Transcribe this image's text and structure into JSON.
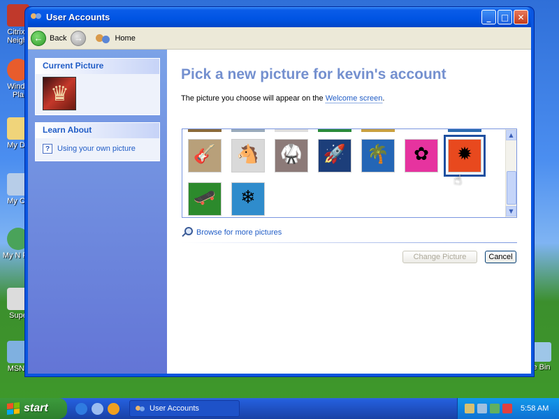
{
  "desktop": {
    "icons": [
      {
        "label": "Citrix I Neight",
        "icon": "citrix-icon"
      },
      {
        "label": "Windo Pla",
        "icon": "media-player-icon"
      },
      {
        "label": "My Do",
        "icon": "my-documents-icon"
      },
      {
        "label": "My Co",
        "icon": "my-computer-icon"
      },
      {
        "label": "My N Pla",
        "icon": "my-network-icon"
      },
      {
        "label": "Supe",
        "icon": "shortcut-icon"
      },
      {
        "label": "MSN I",
        "icon": "msn-icon"
      }
    ],
    "recycle_label": "e Bin"
  },
  "window": {
    "title": "User Accounts",
    "controls": {
      "minimize": "_",
      "maximize": "□",
      "close": "✕"
    }
  },
  "toolbar": {
    "back_label": "Back",
    "home_label": "Home"
  },
  "sidebar": {
    "current_picture_heading": "Current Picture",
    "learn_about_heading": "Learn About",
    "learn_items": [
      {
        "label": "Using your own picture"
      }
    ]
  },
  "main": {
    "title": "Pick a new picture for kevin's account",
    "subtitle_prefix": "The picture you choose will appear on the ",
    "subtitle_link": "Welcome screen",
    "subtitle_suffix": ".",
    "pictures": [
      {
        "name": "guitar",
        "glyph": "🎸",
        "bg": "#b8a07a"
      },
      {
        "name": "horses",
        "glyph": "🐴",
        "bg": "#d9d9d9"
      },
      {
        "name": "karate",
        "glyph": "🥋",
        "bg": "#8c7a78"
      },
      {
        "name": "space-shuttle",
        "glyph": "🚀",
        "bg": "#1c3e7a"
      },
      {
        "name": "palm-trees",
        "glyph": "🌴",
        "bg": "#2466b6"
      },
      {
        "name": "pink-flower",
        "glyph": "✿",
        "bg": "#e6339f"
      },
      {
        "name": "orange-flower",
        "glyph": "✹",
        "bg": "#e8491e",
        "selected": true
      },
      {
        "name": "skateboarder",
        "glyph": "🛹",
        "bg": "#2c8a2c"
      },
      {
        "name": "snowflake",
        "glyph": "❄",
        "bg": "#2f8ccc"
      }
    ],
    "browse_label": "Browse for more pictures",
    "change_button": "Change Picture",
    "cancel_button": "Cancel"
  },
  "taskbar": {
    "start_label": "start",
    "task_label": "User Accounts",
    "clock": "5:58 AM"
  }
}
